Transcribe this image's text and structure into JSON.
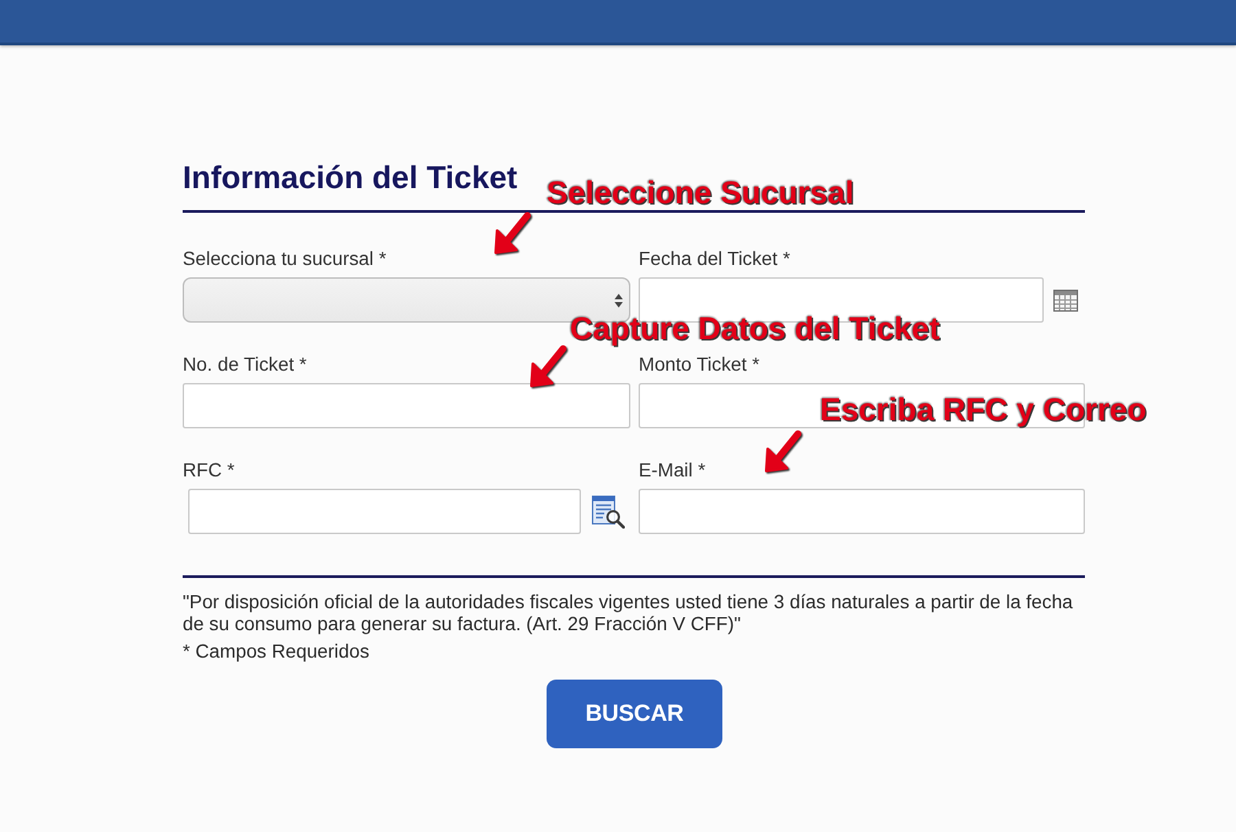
{
  "form": {
    "title": "Información del Ticket",
    "fields": [
      {
        "kind": "select",
        "label": "Selecciona tu sucursal *"
      },
      {
        "kind": "date",
        "label": "Fecha del Ticket *"
      },
      {
        "kind": "text",
        "label": "No. de Ticket *"
      },
      {
        "kind": "text",
        "label": "Monto Ticket *"
      },
      {
        "kind": "lookup",
        "label": "RFC *"
      },
      {
        "kind": "text",
        "label": "E-Mail *"
      }
    ],
    "notice": "\"Por disposición oficial de la autoridades fiscales vigentes usted tiene 3 días naturales a partir de la fecha de su consumo para generar su factura. (Art. 29 Fracción V CFF)\"",
    "required_note": "* Campos Requeridos",
    "submit_button": "BUSCAR"
  },
  "annotations": [
    {
      "text": "Seleccione Sucursal"
    },
    {
      "text": "Capture Datos del Ticket"
    },
    {
      "text": "Escriba RFC y Correo"
    }
  ]
}
